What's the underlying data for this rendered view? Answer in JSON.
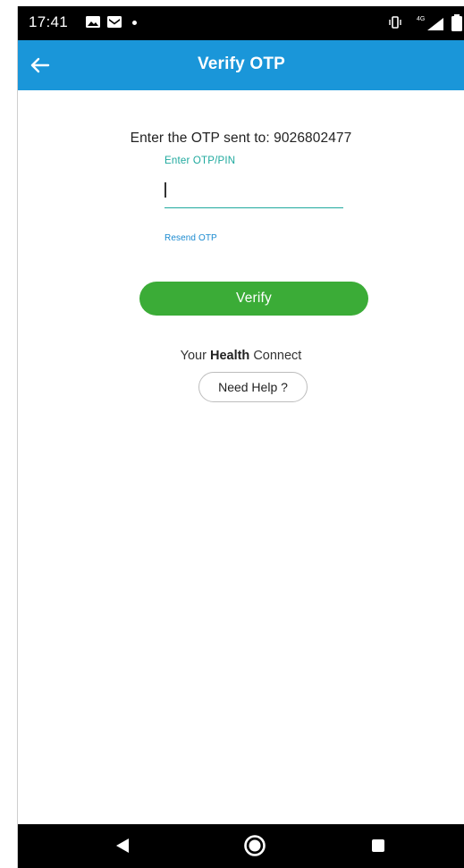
{
  "status_bar": {
    "time": "17:41",
    "icons": [
      "gallery-icon",
      "mail-icon",
      "notification-dot-icon",
      "vibrate-icon",
      "signal-icon",
      "battery-icon"
    ],
    "network_label": "4G"
  },
  "app_bar": {
    "title": "Verify OTP",
    "back_icon": "arrow-left-icon",
    "color": "#1a96d9"
  },
  "otp_form": {
    "prompt": "Enter the OTP sent to: 9026802477",
    "field_label": "Enter OTP/PIN",
    "field_value": "",
    "resend_label": "Resend OTP",
    "verify_label": "Verify",
    "accent_color": "#1fa99e",
    "button_color": "#3bac37"
  },
  "footer": {
    "tagline_pre": "Your ",
    "tagline_strong": "Health",
    "tagline_post": " Connect",
    "help_label": "Need Help ?"
  },
  "nav_bar": {
    "icons": [
      "nav-back-icon",
      "nav-home-icon",
      "nav-recents-icon"
    ]
  }
}
